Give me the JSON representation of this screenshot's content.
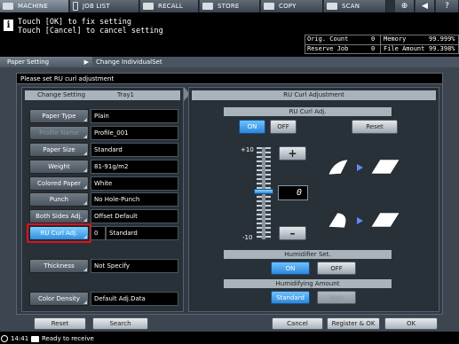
{
  "tabs": {
    "machine": "MACHINE",
    "job_list": "JOB LIST",
    "recall": "RECALL",
    "store": "STORE",
    "copy": "COPY",
    "scan": "SCAN"
  },
  "message": {
    "line1": "Touch [OK] to fix setting",
    "line2": "Touch [Cancel] to cancel setting"
  },
  "status": {
    "orig_count_label": "Orig. Count",
    "orig_count_value": "0",
    "memory_label": "Memory",
    "memory_value": "99.999%",
    "reserve_job_label": "Reserve Job",
    "reserve_job_value": "0",
    "file_amount_label": "File Amount",
    "file_amount_value": "99.398%"
  },
  "breadcrumb": {
    "parent": "Paper Setting",
    "current": "Change IndividualSet"
  },
  "instruction": "Please set RU curl adjustment",
  "left_panel": {
    "header_left": "Change Setting",
    "header_right": "Tray1",
    "rows": [
      {
        "label": "Paper Type",
        "value": "Plain"
      },
      {
        "label": "Profile Name",
        "value": "Profile_001"
      },
      {
        "label": "Paper Size",
        "value": "Standard"
      },
      {
        "label": "Weight",
        "value": "81-91g/m2"
      },
      {
        "label": "Colored Paper",
        "value": "White"
      },
      {
        "label": "Punch",
        "value": "No Hole-Punch"
      },
      {
        "label": "Both Sides Adj.",
        "value": "Offset Default"
      },
      {
        "label": "RU Curl Adj.",
        "value_num": "0",
        "value": "Standard"
      },
      {
        "label": "Thickness",
        "value": "Not Specify"
      },
      {
        "label": "Color Density",
        "value": "Default Adj.Data"
      }
    ]
  },
  "right_panel": {
    "header": "RU Curl Adjustment",
    "curl_header": "RU Curl Adj.",
    "on": "ON",
    "off": "OFF",
    "reset": "Reset",
    "scale_top": "+10",
    "scale_bottom": "-10",
    "plus": "+",
    "minus": "–",
    "level": "0",
    "humidifier_header": "Humidifier Set.",
    "hum_on": "ON",
    "hum_off": "OFF",
    "amount_header": "Humidifying Amount",
    "standard": "Standard",
    "high": "High"
  },
  "bottom": {
    "reset": "Reset",
    "search": "Search",
    "cancel": "Cancel",
    "register_ok": "Register & OK",
    "ok": "OK"
  },
  "footer": {
    "time": "14:41",
    "status": "Ready to receive"
  }
}
